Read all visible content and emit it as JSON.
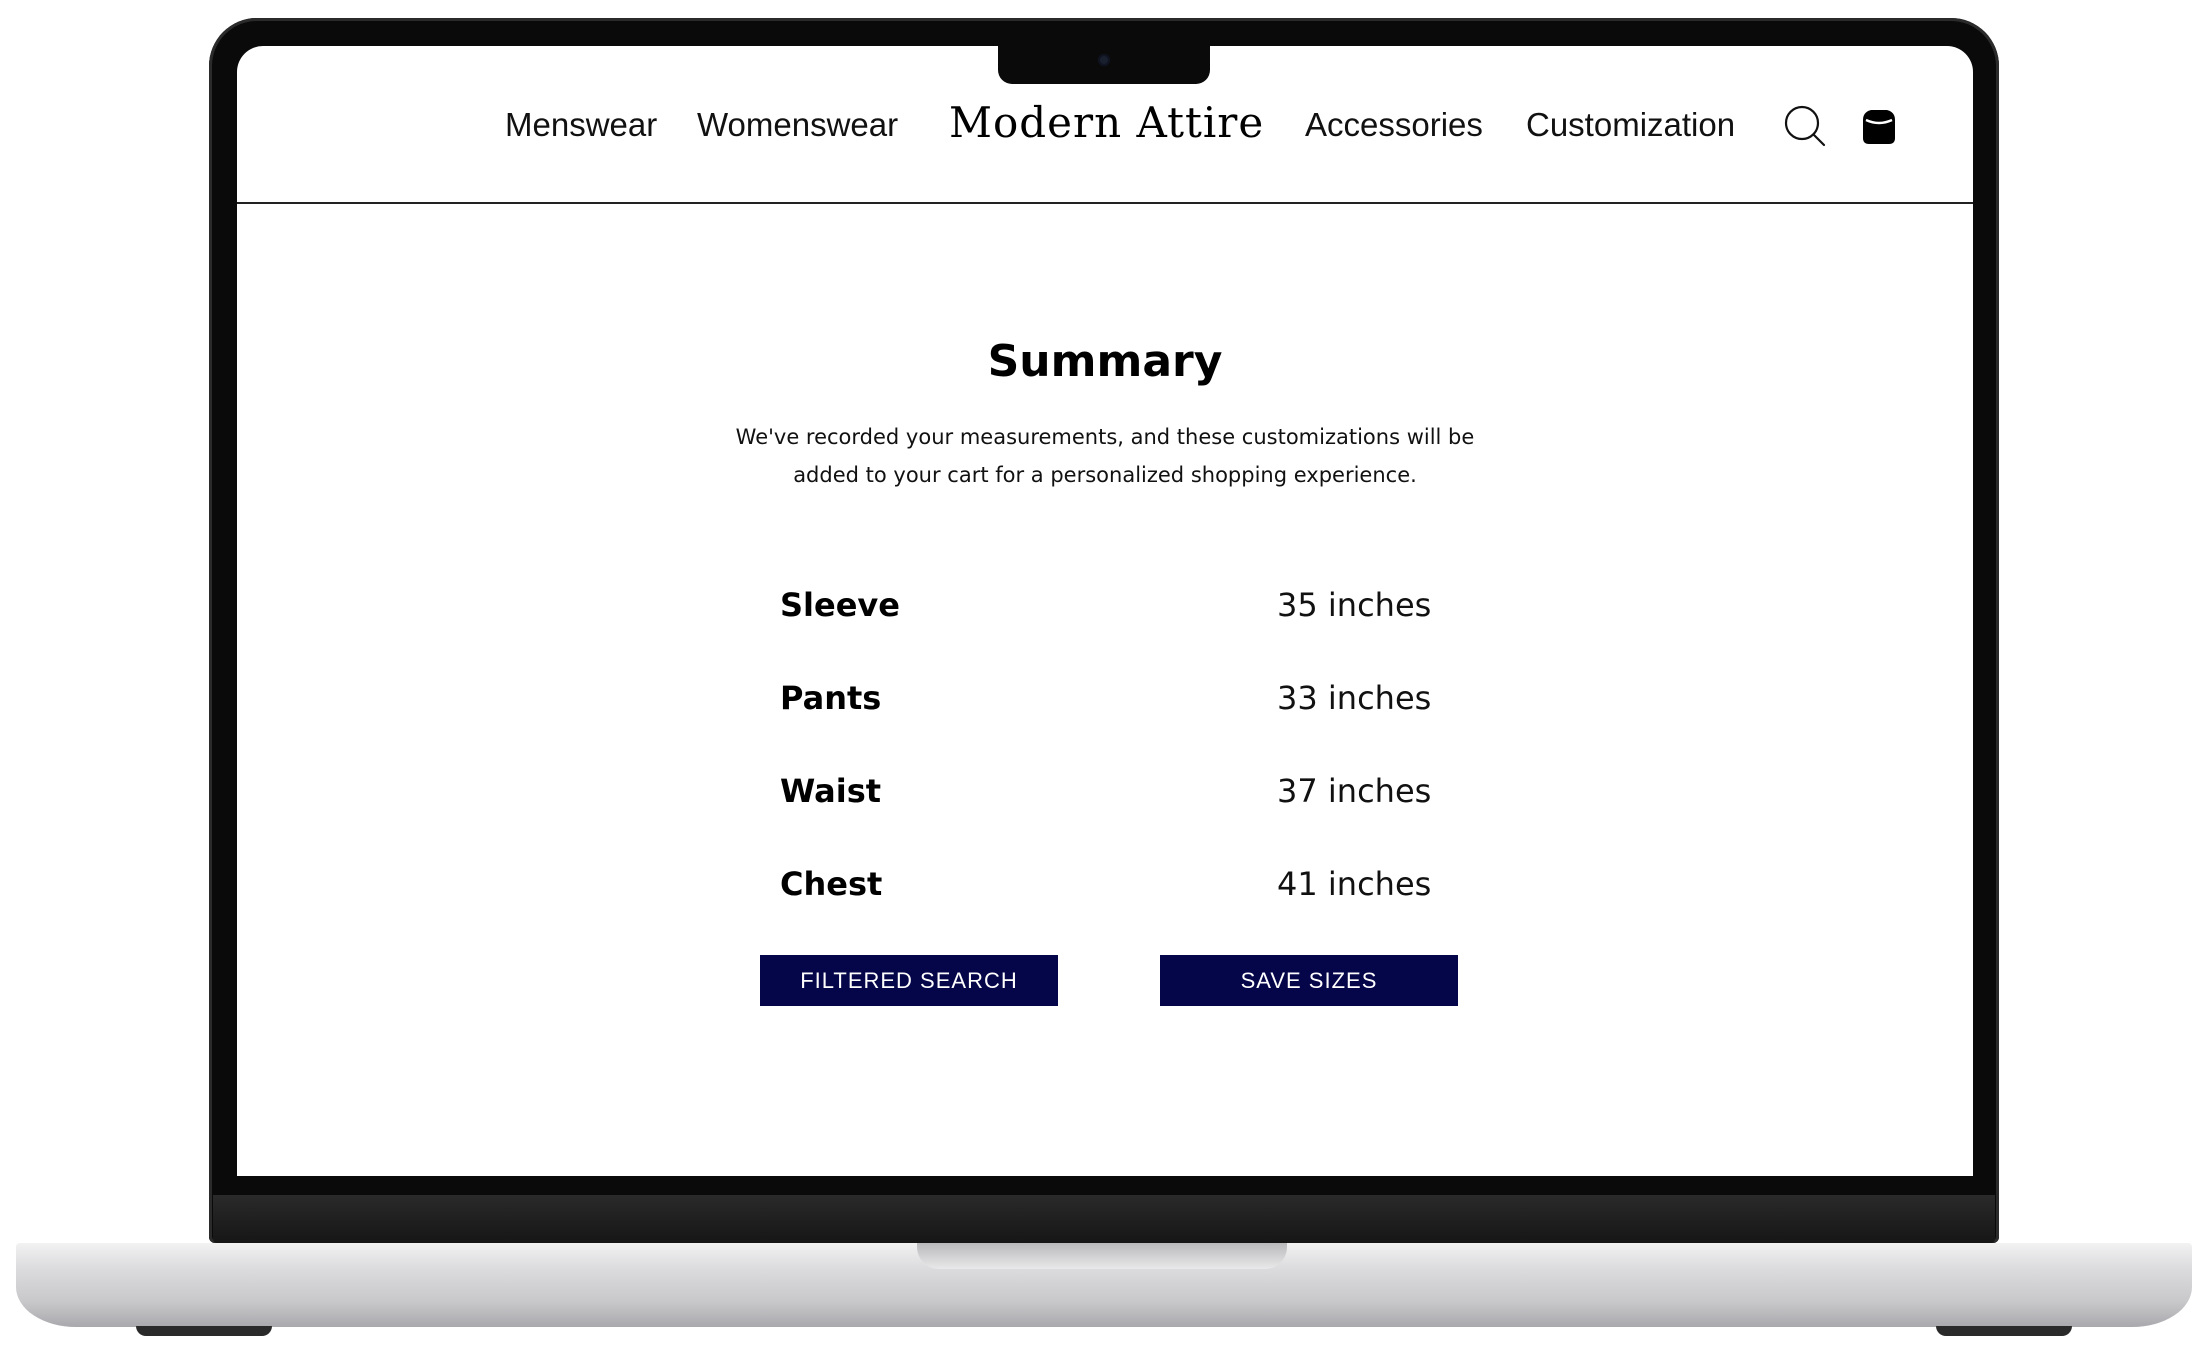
{
  "nav": {
    "links_left": [
      "Menswear",
      "Womenswear"
    ],
    "brand": "Modern Attire",
    "links_right": [
      "Accessories",
      "Customization"
    ],
    "icons": [
      "search-icon",
      "bag-icon"
    ]
  },
  "summary": {
    "title": "Summary",
    "description": "We've recorded your measurements, and these customizations will be added to your cart for a personalized shopping experience.",
    "measurements": [
      {
        "label": "Sleeve",
        "value": "35 inches"
      },
      {
        "label": "Pants",
        "value": "33 inches"
      },
      {
        "label": "Waist",
        "value": "37 inches"
      },
      {
        "label": "Chest",
        "value": "41 inches"
      }
    ]
  },
  "actions": {
    "filtered_search": "FILTERED SEARCH",
    "save_sizes": "SAVE SIZES"
  },
  "colors": {
    "button_bg": "#05054a",
    "button_text": "#ffffff"
  }
}
